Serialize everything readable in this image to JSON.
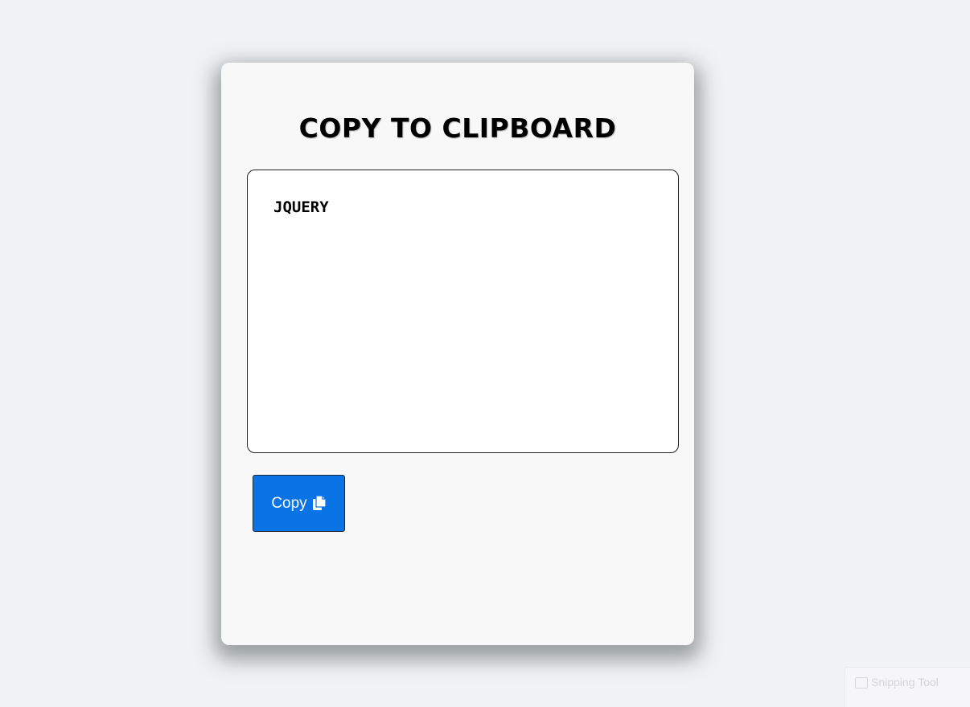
{
  "card": {
    "title": "COPY TO CLIPBOARD",
    "textarea_value": "JQUERY",
    "copy_button_label": "Copy",
    "copy_icon": "copy-icon"
  },
  "overlay": {
    "snipping_tool_label": "Snipping Tool",
    "snipping_tool_icon": "snipping-tool-icon"
  },
  "colors": {
    "background": "#f1f2f6",
    "card": "#f8f8f8",
    "button": "#0a73e6"
  }
}
